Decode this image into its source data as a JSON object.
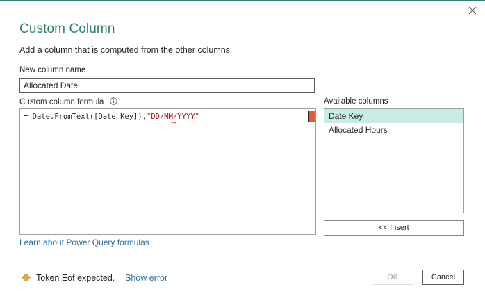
{
  "dialog": {
    "title": "Custom Column",
    "subtitle": "Add a column that is computed from the other columns."
  },
  "new_column": {
    "label": "New column name",
    "value": "Allocated Date"
  },
  "formula": {
    "label": "Custom column formula",
    "code_prefix": "= Date.FromText([Date Key]),",
    "code_string": "\"DD/MM/YYYY\""
  },
  "available_columns": {
    "label": "Available columns",
    "items": [
      "Date Key",
      "Allocated Hours"
    ],
    "selected_index": 0,
    "insert_label": "<< Insert"
  },
  "learn_link": "Learn about Power Query formulas",
  "status": {
    "message": "Token Eof expected.",
    "show_error_label": "Show error",
    "warning_color": "#d9a441"
  },
  "buttons": {
    "ok_label": "OK",
    "cancel_label": "Cancel"
  },
  "colors": {
    "accent": "#2f7f74",
    "link": "#2f6f9f",
    "selection": "#c8ece5",
    "error_marker": "#e8563f"
  }
}
